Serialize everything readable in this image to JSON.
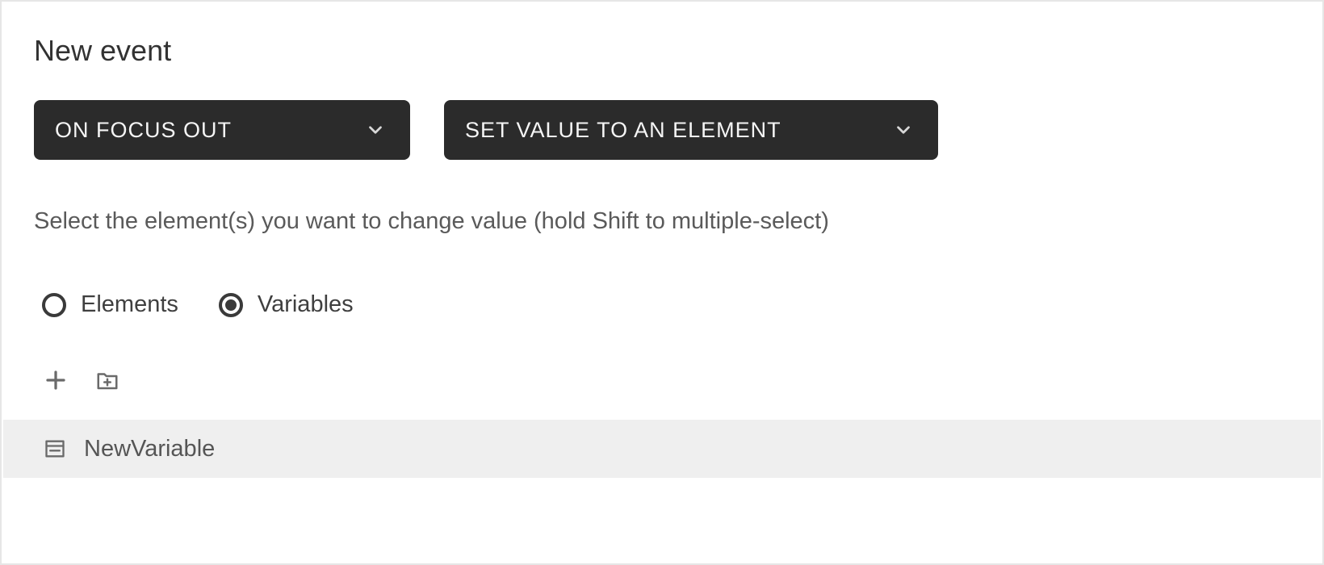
{
  "title": "New event",
  "dropdowns": {
    "event": {
      "label": "ON FOCUS OUT"
    },
    "action": {
      "label": "SET VALUE TO AN ELEMENT"
    }
  },
  "instruction": "Select the element(s) you want to change value (hold Shift to multiple-select)",
  "radios": {
    "elements": {
      "label": "Elements",
      "checked": false
    },
    "variables": {
      "label": "Variables",
      "checked": true
    }
  },
  "list": {
    "items": [
      {
        "label": "NewVariable"
      }
    ]
  }
}
